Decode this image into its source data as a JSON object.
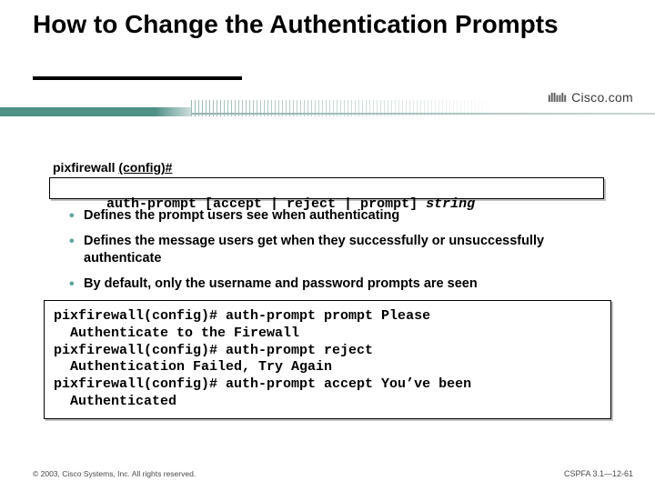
{
  "title": "How to Change the Authentication Prompts",
  "brand": {
    "name": "Cisco.com",
    "logo_name": "cisco-logo"
  },
  "config_prompt": {
    "host": "pixfirewall",
    "mode": "(config)#"
  },
  "syntax": {
    "text": "auth-prompt [accept | reject | prompt] ",
    "arg": "string"
  },
  "bullets": [
    "Defines the prompt users see when authenticating",
    "Defines the message users get when they successfully or unsuccessfully authenticate",
    "By default, only the username and password prompts are seen"
  ],
  "example": {
    "lines": [
      "pixfirewall(config)# auth-prompt prompt Please",
      "  Authenticate to the Firewall",
      "pixfirewall(config)# auth-prompt reject",
      "  Authentication Failed, Try Again",
      "pixfirewall(config)# auth-prompt accept You’ve been",
      "  Authenticated"
    ]
  },
  "footer": {
    "copyright": "© 2003, Cisco Systems, Inc. All rights reserved.",
    "page_id": "CSPFA 3.1—12-61"
  }
}
